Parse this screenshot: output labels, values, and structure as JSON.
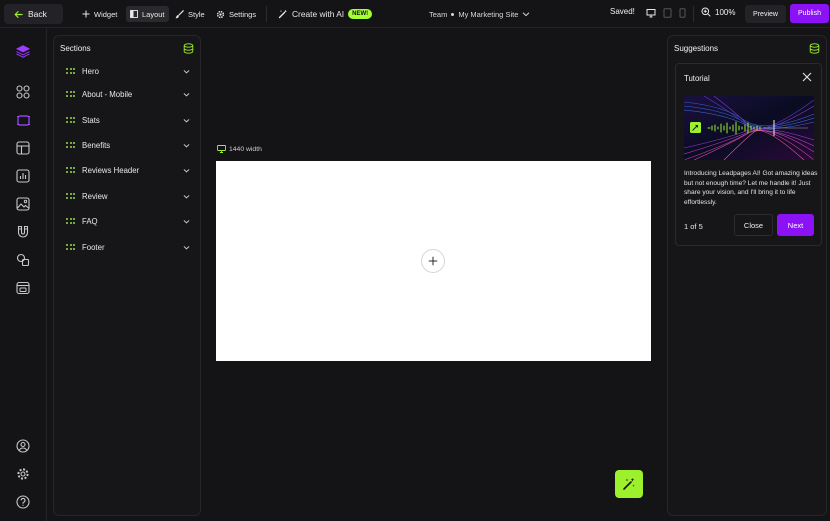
{
  "topbar": {
    "back_label": "Back",
    "widget_label": "Widget",
    "layout_label": "Layout",
    "style_label": "Style",
    "settings_label": "Settings",
    "create_ai_label": "Create with AI",
    "new_badge": "NEW!",
    "team_label": "Team",
    "site_name": "My Marketing Site",
    "saved_label": "Saved!",
    "zoom_label": "100%",
    "preview_label": "Preview",
    "publish_label": "Publish"
  },
  "sections_panel": {
    "title": "Sections",
    "items": [
      {
        "label": "Hero"
      },
      {
        "label": "About - Mobile"
      },
      {
        "label": "Stats"
      },
      {
        "label": "Benefits"
      },
      {
        "label": "Reviews Header"
      },
      {
        "label": "Review"
      },
      {
        "label": "FAQ"
      },
      {
        "label": "Footer"
      }
    ]
  },
  "canvas": {
    "width_label": "1440 width"
  },
  "suggestions_panel": {
    "title": "Suggestions",
    "tutorial": {
      "title": "Tutorial",
      "body": "Introducing Leadpages AI!  Got amazing ideas but not enough time? Let me handle it! Just share your vision, and I'll bring it to life effortlessly.",
      "counter": "1 of 5",
      "close_label": "Close",
      "next_label": "Next"
    }
  },
  "colors": {
    "accent_purple": "#8a12f5",
    "accent_green": "#a6ff33",
    "background": "#141416"
  }
}
